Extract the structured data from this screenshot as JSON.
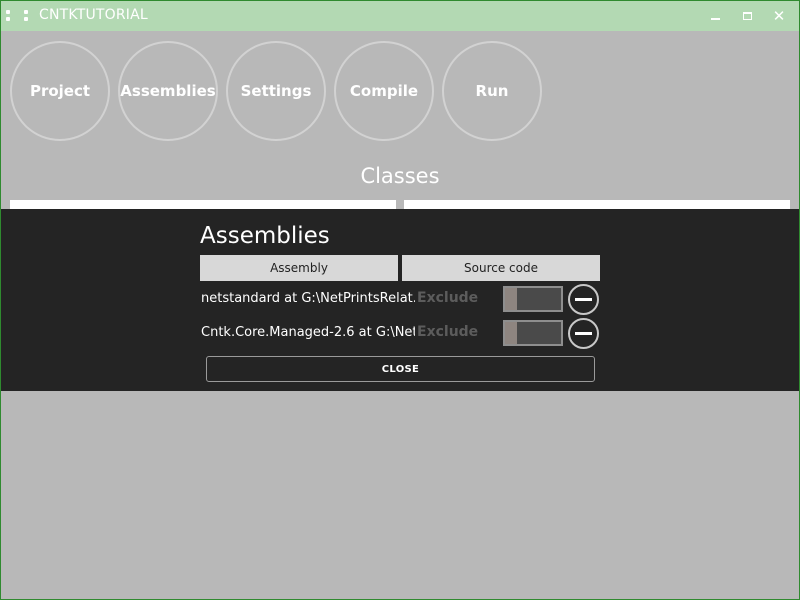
{
  "window": {
    "title": "CNTKTUTORIAL"
  },
  "nav": {
    "items": [
      {
        "label": "Project"
      },
      {
        "label": "Assemblies"
      },
      {
        "label": "Settings"
      },
      {
        "label": "Compile"
      },
      {
        "label": "Run"
      }
    ]
  },
  "main": {
    "section_title": "Classes"
  },
  "dialog": {
    "title": "Assemblies",
    "columns": [
      "Assembly",
      "Source code"
    ],
    "rows": [
      {
        "name": "netstandard at G:\\NetPrintsRelat...",
        "exclude_label": "Exclude",
        "exclude_on": false
      },
      {
        "name": "Cntk.Core.Managed-2.6 at G:\\Net...",
        "exclude_label": "Exclude",
        "exclude_on": false
      }
    ],
    "close_label": "CLOSE"
  },
  "colors": {
    "window_border": "#2f8a2f",
    "titlebar": "#b3d9b3",
    "background": "#b8b8b8",
    "overlay": "#242424"
  },
  "icons": {
    "app": "app-icon",
    "minimize": "minimize-icon",
    "maximize": "maximize-icon",
    "close": "close-icon",
    "remove": "minus-circle-icon"
  }
}
